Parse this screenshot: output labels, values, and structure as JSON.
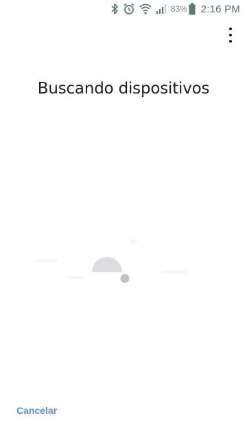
{
  "status_bar": {
    "battery_percent": "83%",
    "time": "2:16 PM",
    "icons": [
      "bluetooth-icon",
      "alarm-icon",
      "wifi-icon",
      "signal-icon",
      "battery-icon"
    ],
    "icon_color": "#5d7a6a"
  },
  "header": {
    "menu_icon": "more-vert-icon"
  },
  "main": {
    "title": "Buscando dispositivos"
  },
  "footer": {
    "cancel_label": "Cancelar",
    "cancel_color": "#5b8fd9"
  }
}
